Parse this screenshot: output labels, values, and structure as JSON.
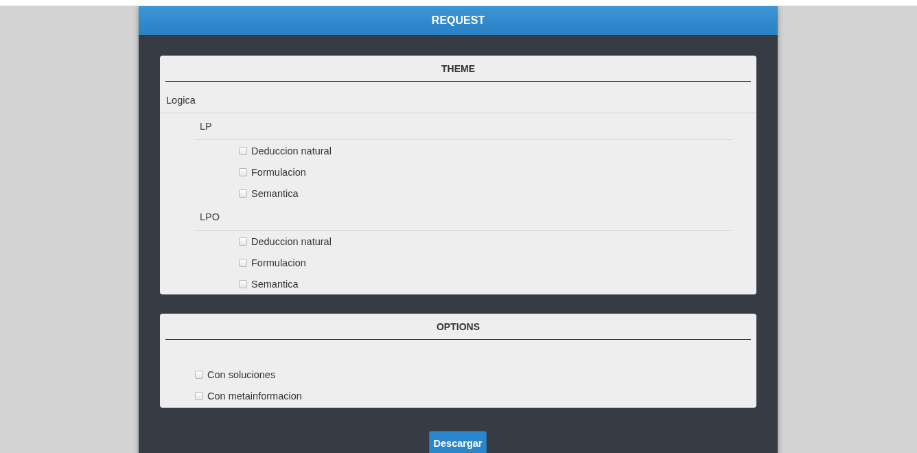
{
  "header": {
    "title": "REQUEST"
  },
  "theme": {
    "title": "THEME",
    "children": [
      {
        "label": "Logica",
        "children": [
          {
            "label": "LP",
            "children": [
              {
                "label": "Deduccion natural",
                "checked": false
              },
              {
                "label": "Formulacion",
                "checked": false
              },
              {
                "label": "Semantica",
                "checked": false
              }
            ]
          },
          {
            "label": "LPO",
            "children": [
              {
                "label": "Deduccion natural",
                "checked": false
              },
              {
                "label": "Formulacion",
                "checked": false
              },
              {
                "label": "Semantica",
                "checked": false
              }
            ]
          }
        ]
      }
    ]
  },
  "options": {
    "title": "OPTIONS",
    "items": [
      {
        "label": "Con soluciones",
        "checked": false
      },
      {
        "label": "Con metainformacion",
        "checked": false
      }
    ]
  },
  "button": {
    "label": "Descargar"
  }
}
